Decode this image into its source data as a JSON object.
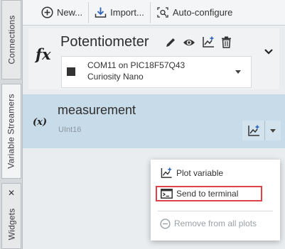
{
  "left_tabs": {
    "connections": "Connections",
    "variable_streamers": "Variable Streamers",
    "widgets": "Widgets",
    "widgets_close": "✕"
  },
  "toolbar": {
    "new_label": "New...",
    "import_label": "Import...",
    "autoconfigure_label": "Auto-configure"
  },
  "streamer": {
    "fx_symbol": "fx",
    "title": "Potentiometer",
    "connection_line1": "COM11 on PIC18F57Q43",
    "connection_line2": "Curiosity Nano"
  },
  "variable": {
    "symbol": "(x)",
    "name": "measurement",
    "type": "UInt16"
  },
  "context_menu": {
    "plot_variable": "Plot variable",
    "send_to_terminal": "Send to terminal",
    "remove_from_all_plots": "Remove from all plots"
  },
  "colors": {
    "selected_card": "#c8dbe8",
    "highlight_border": "#e0424a",
    "disabled_text": "#9aa1a7"
  }
}
